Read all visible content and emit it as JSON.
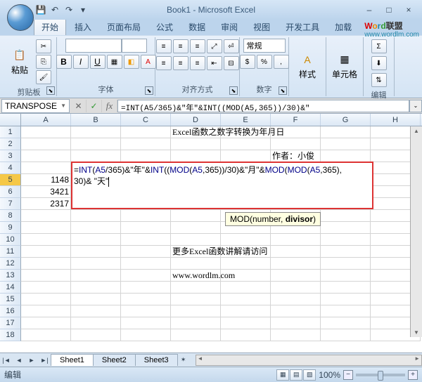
{
  "title": "Book1 - Microsoft Excel",
  "brand": {
    "w": "W",
    "o": "o",
    "r": "r",
    "d": "d",
    "lm": "联盟",
    "url": "www.wordlm.com"
  },
  "tabs": [
    "开始",
    "插入",
    "页面布局",
    "公式",
    "数据",
    "审阅",
    "视图",
    "开发工具",
    "加载"
  ],
  "active_tab": 0,
  "ribbon": {
    "clipboard": {
      "label": "剪贴板",
      "paste": "粘贴"
    },
    "font": {
      "label": "字体",
      "fontname": "",
      "fontsize": ""
    },
    "align": {
      "label": "对齐方式",
      "general": "常规"
    },
    "number": {
      "label": "数字"
    },
    "styles": {
      "label": "样式",
      "btn": "样式"
    },
    "cells": {
      "label": "单元格",
      "btn": "单元格"
    },
    "editing": {
      "label": "编辑"
    }
  },
  "namebox": "TRANSPOSE",
  "formula_bar": "=INT(A5/365)&\"年\"&INT((MOD(A5,365))/30)&\"",
  "columns": [
    "A",
    "B",
    "C",
    "D",
    "E",
    "F",
    "G",
    "H"
  ],
  "rows": 18,
  "active_row": 5,
  "cells": {
    "D1": "Excel函数之数字转换为年月日",
    "F3": "作者：小俊",
    "A5": "1148",
    "A6": "3421",
    "A7": "2317",
    "D11": "更多Excel函数讲解请访问",
    "D13": "www.wordlm.com"
  },
  "formula_overlay": {
    "line1_parts": [
      "=",
      "INT",
      "(",
      "A5",
      "/",
      "365",
      ")&\"年\"&",
      "INT",
      "((",
      "MOD",
      "(",
      "A5",
      ",",
      "365",
      "))/",
      "30",
      ")&\"月\"&",
      "MOD",
      "(",
      "MOD",
      "(",
      "A5",
      ",",
      "365",
      "),"
    ],
    "line2_parts": [
      "30",
      ")& \"天\""
    ]
  },
  "tooltip": {
    "prefix": "MOD(number, ",
    "bold": "divisor",
    "suffix": ")"
  },
  "sheet_tabs": [
    "Sheet1",
    "Sheet2",
    "Sheet3"
  ],
  "active_sheet": 0,
  "status": "编辑",
  "zoom": "100%"
}
